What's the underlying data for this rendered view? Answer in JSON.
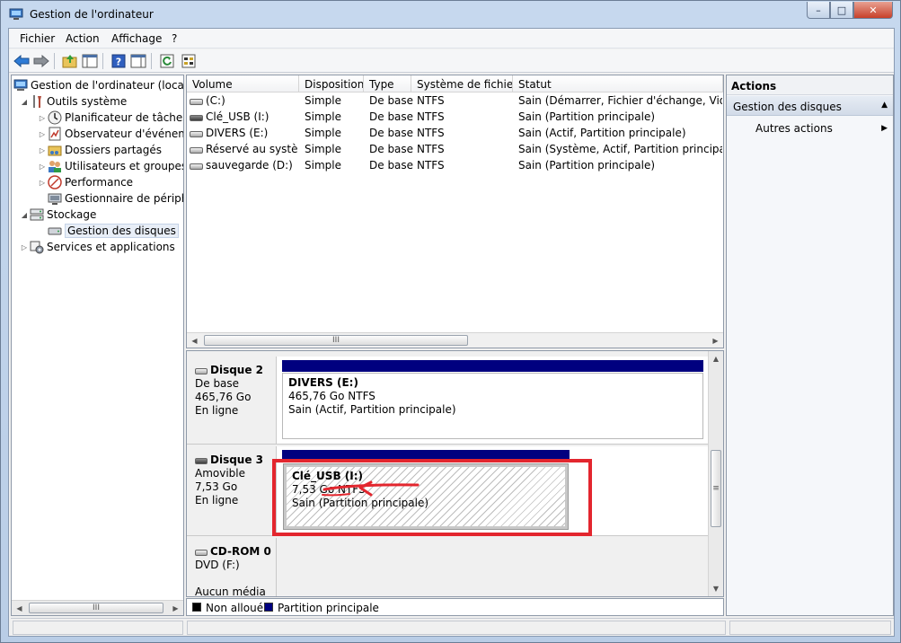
{
  "window": {
    "title": "Gestion de l'ordinateur",
    "controls": {
      "minimize": "–",
      "maximize": "□",
      "close": "✕"
    }
  },
  "menu": [
    "Fichier",
    "Action",
    "Affichage",
    "?"
  ],
  "tree": {
    "root": "Gestion de l'ordinateur (local)",
    "outils": "Outils système",
    "planificateur": "Planificateur de tâches",
    "observateur": "Observateur d'événeme",
    "dossiers": "Dossiers partagés",
    "utilisateurs": "Utilisateurs et groupes l",
    "performance": "Performance",
    "gestionnaire": "Gestionnaire de périphé",
    "stockage": "Stockage",
    "gestion_disques": "Gestion des disques",
    "services": "Services et applications"
  },
  "volume_list": {
    "columns": [
      "Volume",
      "Disposition",
      "Type",
      "Système de fichiers",
      "Statut"
    ],
    "rows": [
      {
        "volume": "(C:)",
        "disposition": "Simple",
        "type": "De base",
        "fs": "NTFS",
        "statut": "Sain (Démarrer, Fichier d'échange, Vidage s"
      },
      {
        "volume": "Clé_USB (I:)",
        "disposition": "Simple",
        "type": "De base",
        "fs": "NTFS",
        "statut": "Sain (Partition principale)"
      },
      {
        "volume": "DIVERS (E:)",
        "disposition": "Simple",
        "type": "De base",
        "fs": "NTFS",
        "statut": "Sain (Actif, Partition principale)"
      },
      {
        "volume": "Réservé au système",
        "disposition": "Simple",
        "type": "De base",
        "fs": "NTFS",
        "statut": "Sain (Système, Actif, Partition principale)"
      },
      {
        "volume": "sauvegarde (D:)",
        "disposition": "Simple",
        "type": "De base",
        "fs": "NTFS",
        "statut": "Sain (Partition principale)"
      }
    ],
    "scroll_thumb": "III"
  },
  "disks": [
    {
      "name": "Disque 2",
      "kind": "De base",
      "size": "465,76 Go",
      "state": "En ligne",
      "partition": {
        "name": "DIVERS  (E:)",
        "size_fs": "465,76 Go NTFS",
        "status": "Sain (Actif, Partition principale)"
      }
    },
    {
      "name": "Disque 3",
      "kind": "Amovible",
      "size": "7,53 Go",
      "state": "En ligne",
      "partition": {
        "name": "Clé_USB  (I:)",
        "size_fs": "7,53 Go NTFS",
        "status": "Sain (Partition principale)"
      }
    },
    {
      "name": "CD-ROM 0",
      "kind": "DVD (F:)",
      "size": "",
      "state": "Aucun média"
    }
  ],
  "legend": {
    "unallocated": "Non alloué",
    "primary": "Partition principale",
    "unallocated_color": "#000000",
    "primary_color": "#00007f"
  },
  "actions": {
    "header": "Actions",
    "section": "Gestion des disques",
    "item": "Autres actions"
  },
  "annotation": {
    "color": "#e3262e"
  }
}
